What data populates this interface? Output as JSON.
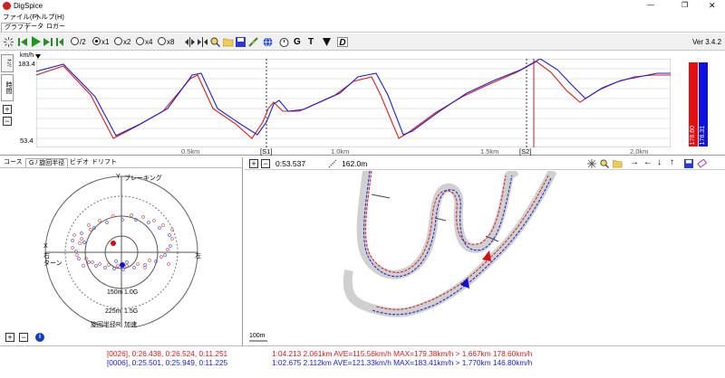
{
  "window": {
    "title": "DigSpice",
    "minimize": "—",
    "maximize": "❐",
    "close": "✕"
  },
  "menu": [
    "ファイル(F)",
    "ヘルプ(H)"
  ],
  "main_tabs": [
    "グラフ",
    "データ",
    "ロガー"
  ],
  "toolbar": {
    "speed_options": [
      "/2",
      "x1",
      "x2",
      "x4",
      "x8"
    ],
    "selected_speed": "x1",
    "version": "Ver 3.4.2",
    "icons": [
      "burst-icon",
      "skip-start-icon",
      "play-icon",
      "step-forward-icon",
      "skip-end-icon",
      "expand-h-icon",
      "compress-h-icon",
      "search-icon",
      "folder-open-icon",
      "save-icon",
      "link-icon",
      "globe-icon",
      "stopwatch-icon",
      "g-letter-icon",
      "t-letter-icon",
      "filter-icon",
      "d-letter-icon"
    ],
    "letters": {
      "g": "G",
      "t": "T",
      "d": "D"
    }
  },
  "speed_chart": {
    "unit": "km/h",
    "side_tabs": [
      "ｷｮﾘ",
      "時間"
    ],
    "y_max": "183.4",
    "y_min": "53.4",
    "x_ticks": [
      "0.5km",
      "1.0km",
      "1.5km",
      "2.0km"
    ],
    "sector_labels": [
      "[S1]",
      "[S2]"
    ],
    "bar_values": [
      "178.60",
      "178.31"
    ],
    "colors": {
      "red": "#d42020",
      "blue": "#2020d0"
    }
  },
  "g_panel": {
    "tabs": [
      "コース",
      "G / 旋回半径",
      "ビデオ",
      "ドリフト"
    ],
    "labels": {
      "y": "Y",
      "braking": "ブレーキング",
      "x": "X",
      "right": "右",
      "turn": "ターン",
      "left": "左",
      "r150": "150m",
      "g10": "1.0G",
      "r225": "225m",
      "g15": "1.5G",
      "radius_r": "旋回半径R",
      "accel": "加速"
    }
  },
  "map_panel": {
    "time": "0:53.537",
    "distance": "162.0m",
    "scale": "100m"
  },
  "status": {
    "red_left": "[0026], 0:26.438, 0:26.524, 0:11.251",
    "red_right": "1:04.213 2.061km AVE=115.56km/h MAX=179.38km/h > 1.667km 178.60km/h",
    "blue_left": "[0006], 0:25.501, 0:25.949, 0:11.225",
    "blue_right": "1:02.675 2.112km AVE=121.33km/h MAX=183.41km/h > 1.770km 146.80km/h"
  }
}
